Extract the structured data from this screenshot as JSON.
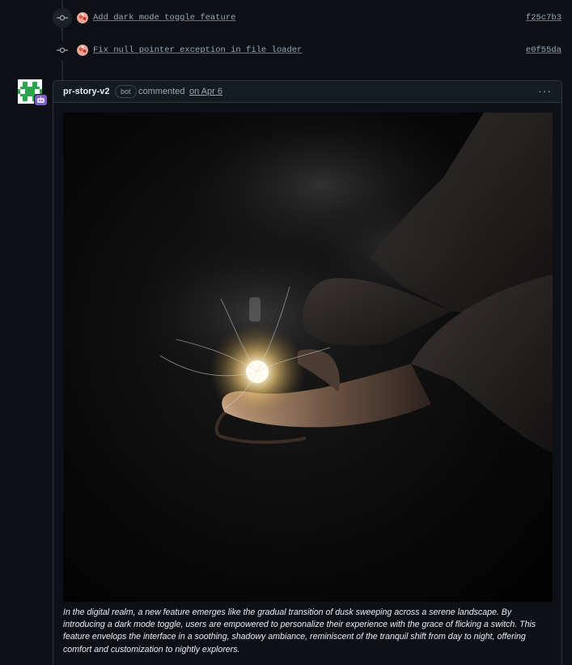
{
  "commits": [
    {
      "message": "Add dark mode toggle feature",
      "sha": "f25c7b3"
    },
    {
      "message": "Fix null pointer exception in file loader",
      "sha": "e0f55da"
    }
  ],
  "comment": {
    "author": "pr-story-v2",
    "badge": "bot",
    "action": "commented",
    "date": "on Apr 6",
    "menu_icon": "kebab-horizontal-icon",
    "body": "In the digital realm, a new feature emerges like the gradual transition of dusk sweeping across a serene landscape. By introducing a dark mode toggle, users are empowered to personalize their experience with the grace of flicking a switch. This feature envelops the interface in a soothing, shadowy ambiance, reminiscent of the tranquil shift from day to night, offering comfort and customization to nightly explorers."
  },
  "colors": {
    "background": "#0d1117",
    "border": "#30363d",
    "header_bg": "#161b22",
    "muted_text": "#9da7b3",
    "bot_badge": "#7a61c2",
    "avatar_green": "#2da44e"
  }
}
